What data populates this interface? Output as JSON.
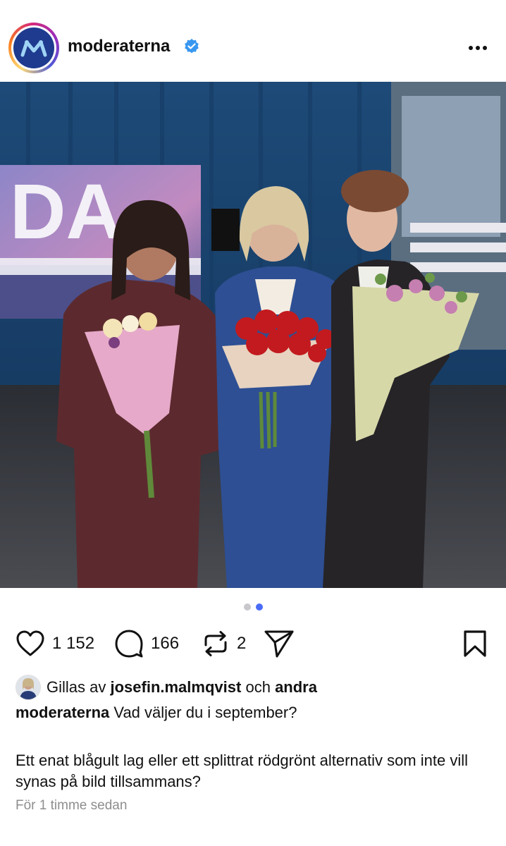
{
  "post": {
    "username": "moderaterna",
    "verified": true,
    "menu_icon": "more-horizontal-icon",
    "image_alt": "Tre kvinnor med blombuketter i en TV-studio",
    "carousel": {
      "total": 2,
      "active": 2
    },
    "likes_count": "1 152",
    "comments_count": "166",
    "reposts_count": "2",
    "liked_by_prefix": "Gillas av",
    "liked_by_user": "josefin.malmqvist",
    "liked_by_conjunction": "och",
    "liked_by_suffix": "andra",
    "caption_user": "moderaterna",
    "caption_line1": "Vad väljer du i september?",
    "caption_paragraph": "Ett enat blågult lag eller ett splittrat rödgrönt alternativ som inte vill synas på bild tillsammans?",
    "timestamp": "För 1 timme sedan"
  },
  "colors": {
    "brand_blue": "#1f3b8f",
    "verified_blue": "#3897f0",
    "dot_active": "#4a6cf7",
    "dot_inactive": "#c7c7cc",
    "muted_text": "#8e8e8e"
  }
}
